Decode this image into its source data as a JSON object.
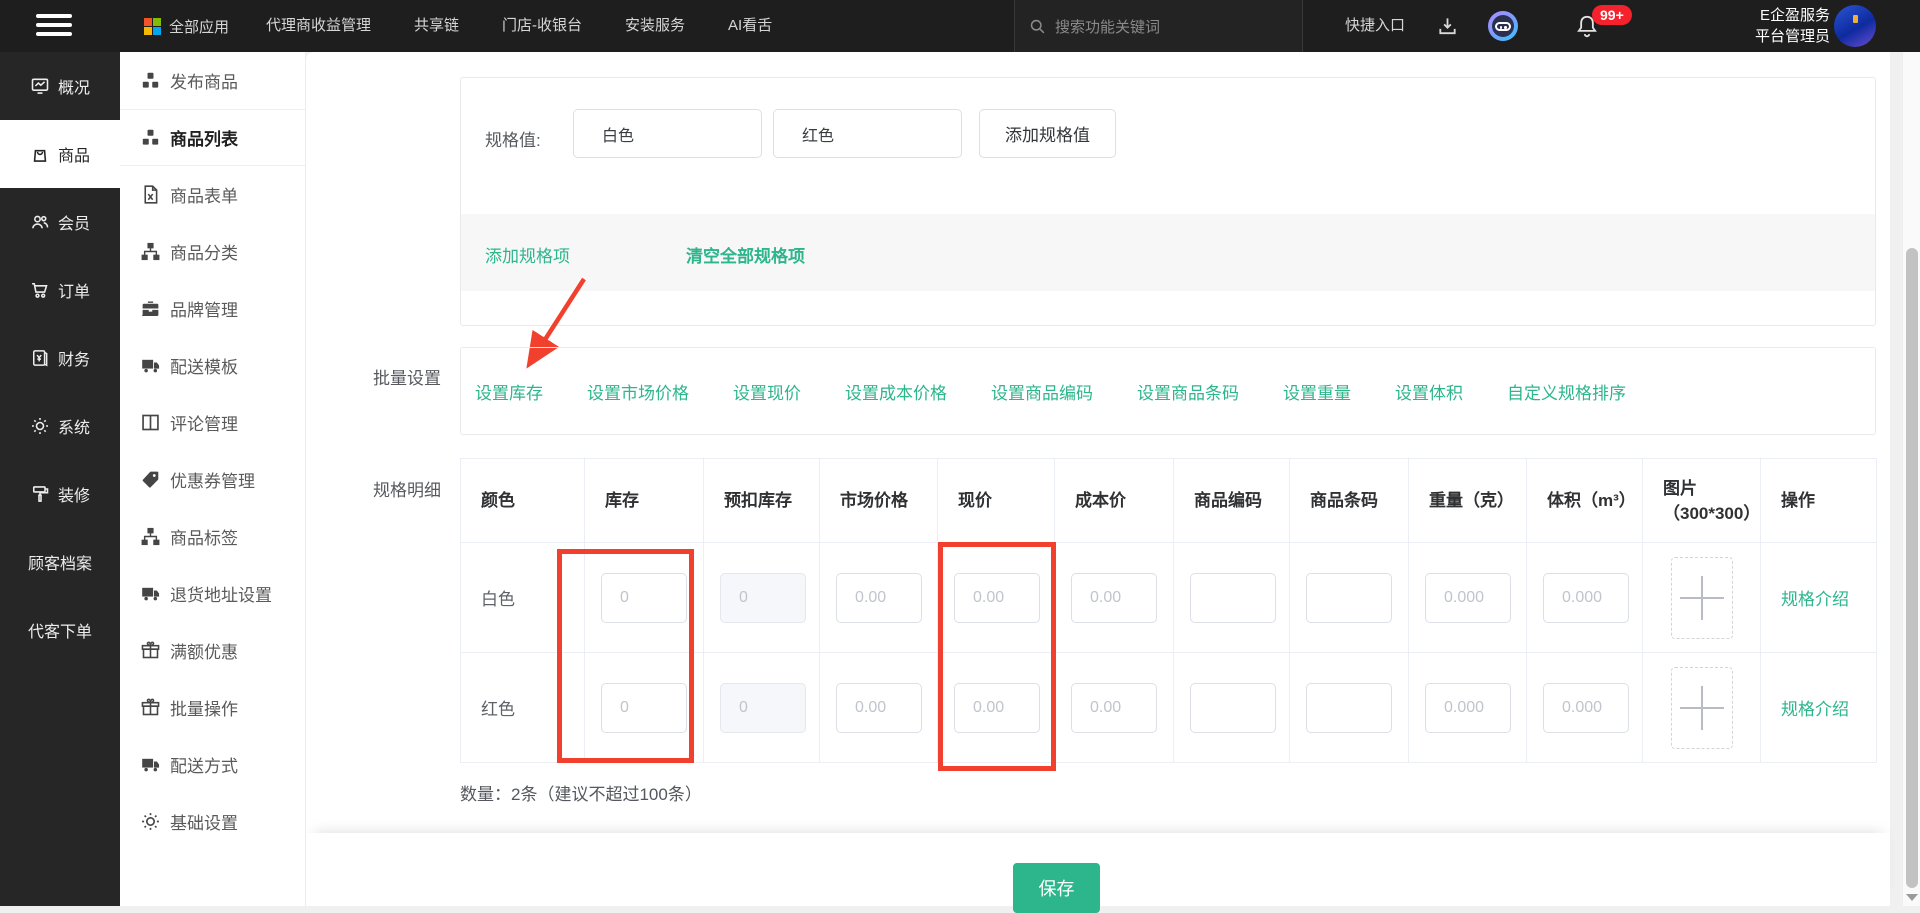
{
  "topbar": {
    "app_menu_label": "全部应用",
    "menu_items": [
      "代理商收益管理",
      "共享链",
      "门店-收银台",
      "安装服务",
      "AI看舌"
    ],
    "search_placeholder": "搜索功能关键词",
    "quick_entry_label": "快捷入口",
    "notification_badge": "99+",
    "profile_name": "E企盈服务",
    "profile_role": "平台管理员"
  },
  "sidebar": {
    "items": [
      {
        "label": "概况",
        "icon": "monitor"
      },
      {
        "label": "商品",
        "icon": "bag",
        "active": true
      },
      {
        "label": "会员",
        "icon": "users"
      },
      {
        "label": "订单",
        "icon": "cart"
      },
      {
        "label": "财务",
        "icon": "finance"
      },
      {
        "label": "系统",
        "icon": "gear"
      },
      {
        "label": "装修",
        "icon": "roller"
      },
      {
        "label": "顾客档案"
      },
      {
        "label": "代客下单"
      }
    ]
  },
  "submenu": {
    "items": [
      {
        "label": "发布商品",
        "icon": "cubes"
      },
      {
        "label": "商品列表",
        "icon": "cubes",
        "active": true
      },
      {
        "label": "商品表单",
        "icon": "file"
      },
      {
        "label": "商品分类",
        "icon": "sitemap"
      },
      {
        "label": "品牌管理",
        "icon": "briefcase"
      },
      {
        "label": "配送模板",
        "icon": "truck"
      },
      {
        "label": "评论管理",
        "icon": "columns"
      },
      {
        "label": "优惠券管理",
        "icon": "tags"
      },
      {
        "label": "商品标签",
        "icon": "sitemap"
      },
      {
        "label": "退货地址设置",
        "icon": "truck"
      },
      {
        "label": "满额优惠",
        "icon": "gift"
      },
      {
        "label": "批量操作",
        "icon": "gift"
      },
      {
        "label": "配送方式",
        "icon": "truck"
      },
      {
        "label": "基础设置",
        "icon": "gear"
      }
    ]
  },
  "spec": {
    "value_label": "规格值:",
    "values": [
      "白色",
      "红色"
    ],
    "add_value_button": "添加规格值",
    "add_item_link": "添加规格项",
    "clear_all_link": "清空全部规格项"
  },
  "batch": {
    "label": "批量设置",
    "links": [
      "设置库存",
      "设置市场价格",
      "设置现价",
      "设置成本价格",
      "设置商品编码",
      "设置商品条码",
      "设置重量",
      "设置体积",
      "自定义规格排序"
    ]
  },
  "detail": {
    "label": "规格明细",
    "headers": [
      "颜色",
      "库存",
      "预扣库存",
      "市场价格",
      "现价",
      "成本价",
      "商品编码",
      "商品条码",
      "重量（克）",
      "体积（m³）",
      "图片（300*300）",
      "操作"
    ],
    "rows": [
      {
        "name": "白色"
      },
      {
        "name": "红色"
      }
    ],
    "placeholders": {
      "stock": "0",
      "pre_stock": "0",
      "market_price": "0.00",
      "price": "0.00",
      "cost": "0.00",
      "code": "",
      "barcode": "",
      "weight": "0.000",
      "volume": "0.000"
    },
    "action_link": "规格介绍",
    "count_text": "数量：2条（建议不超过100条）"
  },
  "footer": {
    "save_button": "保存"
  },
  "colors": {
    "accent_teal": "#2db58c",
    "annotation_red": "#f2402e",
    "badge_red": "#f5222d"
  }
}
